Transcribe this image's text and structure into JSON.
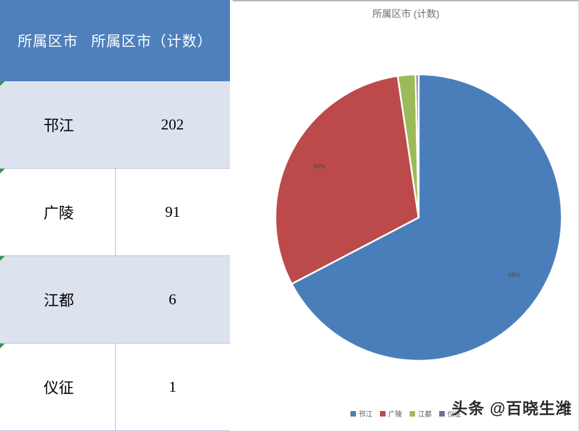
{
  "table": {
    "headers": [
      "所属区市",
      "所属区市（计数）"
    ],
    "rows": [
      {
        "category": "邗江",
        "count": "202"
      },
      {
        "category": "广陵",
        "count": "91"
      },
      {
        "category": "江都",
        "count": "6"
      },
      {
        "category": "仪征",
        "count": "1"
      }
    ]
  },
  "chart": {
    "title": "所属区市 (计数)",
    "legend": [
      {
        "label": "邗江",
        "color": "#4a7ebb"
      },
      {
        "label": "广陵",
        "color": "#bc4a4a"
      },
      {
        "label": "江都",
        "color": "#9bbb59"
      },
      {
        "label": "仪征",
        "color": "#8064a2"
      }
    ],
    "data_labels": [
      "68%",
      "30%"
    ]
  },
  "watermark": {
    "text": "头条 @百晓生潍"
  },
  "colors": {
    "header_blue": "#4e80bc",
    "row_shade": "#dce3ef",
    "grid_line": "#b7c4d8",
    "green_strip": "#3fb08a",
    "title_gray": "#6e6e6e"
  },
  "chart_data": {
    "type": "pie",
    "title": "所属区市 (计数)",
    "categories": [
      "邗江",
      "广陵",
      "江都",
      "仪征"
    ],
    "values": [
      202,
      91,
      6,
      1
    ],
    "percentages": [
      68,
      30,
      2,
      0
    ],
    "displayed_percent_labels": [
      "68%",
      "30%"
    ],
    "colors": [
      "#4a7ebb",
      "#bc4a4a",
      "#9bbb59",
      "#8064a2"
    ],
    "legend_position": "bottom",
    "xlabel": "",
    "ylabel": ""
  }
}
